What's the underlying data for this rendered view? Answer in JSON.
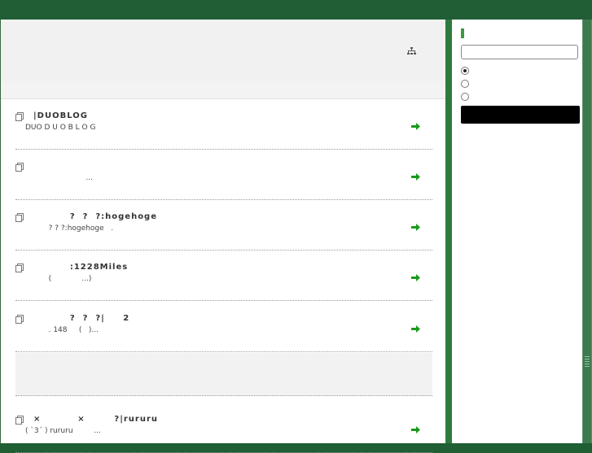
{
  "header": {
    "sitemap_icon": "sitemap-icon"
  },
  "entries": [
    {
      "title": "|DUOBLOG",
      "description": "DUO D U O B L O G"
    },
    {
      "title": "",
      "description": "                          ..."
    },
    {
      "title": "          ?  ?  ?:hogehoge",
      "description": "          ? ? ?:hogehoge   ."
    },
    {
      "title": "          :1228Miles",
      "description": "          (             ...)"
    },
    {
      "title": "          ?  ?  ?|     2",
      "description": "          . 148     (   )..."
    },
    {
      "title": "×          ×        ?|rururu",
      "description": "( `3´ ) rururu         ..."
    }
  ],
  "sidebar": {
    "search_placeholder": "",
    "radio_options": [
      "",
      "",
      ""
    ],
    "selected_index": 0,
    "search_button_label": ""
  },
  "colors": {
    "topbar": "#215d35",
    "accent_green": "#2e7a3f",
    "arrow_green": "#1a9a1a"
  }
}
